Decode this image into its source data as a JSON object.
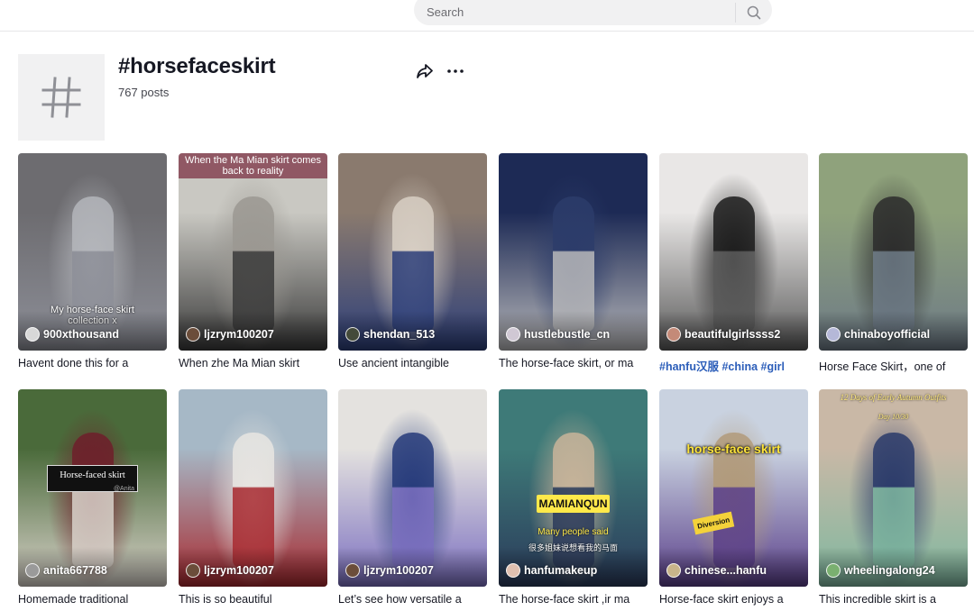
{
  "search": {
    "placeholder": "Search"
  },
  "header": {
    "title": "#horsefaceskirt",
    "post_count": "767 posts"
  },
  "videos": [
    {
      "author": "900xthousand",
      "caption": "Havent done this for a",
      "overlay": "My horse-face skirt collection x",
      "colors": [
        "#6d6c70",
        "#b4b6bb",
        "#8d8f98"
      ],
      "avatar": "#d8d8d8"
    },
    {
      "author": "ljzrym100207",
      "caption": "When zhe Ma Mian skirt",
      "overlay": "When the Ma Mian skirt comes back to reality",
      "colors": [
        "#c9c8c2",
        "#9b9892",
        "#3a3a3a"
      ],
      "avatar": "#6b4d3a"
    },
    {
      "author": "shendan_513",
      "caption": "Use ancient intangible",
      "overlay": "",
      "colors": [
        "#8a7a6e",
        "#d8cfc4",
        "#2d3f7a"
      ],
      "avatar": "#444a3a"
    },
    {
      "author": "hustlebustle_cn",
      "caption": "The horse-face skirt, or ma",
      "overlay": "",
      "colors": [
        "#1d2a55",
        "#2c3c6a",
        "#b8b8ba"
      ],
      "avatar": "#d0c8d4"
    },
    {
      "author": "beautifulgirlssss2",
      "caption": "#hanfu汉服 #china #girl",
      "overlay": "",
      "colors": [
        "#e9e7e6",
        "#1c1c1c",
        "#5a5a5a"
      ],
      "avatar": "#c48a78",
      "caption_is_tags": true
    },
    {
      "author": "chinaboyofficial",
      "caption": "Horse Face Skirt，one of",
      "overlay": "",
      "colors": [
        "#8fa27c",
        "#2c2c2c",
        "#6d7a86"
      ],
      "avatar": "#b5b8d8"
    },
    {
      "author": "anita667788",
      "caption": "Homemade traditional",
      "overlay": "Horse-faced skirt",
      "overlay_sub": "@Anita",
      "colors": [
        "#4a6a3a",
        "#6e1e2a",
        "#d8d2ca"
      ],
      "avatar": "#9a9a9a"
    },
    {
      "author": "ljzrym100207",
      "caption": "This is so beautiful",
      "overlay": "",
      "colors": [
        "#a6b8c6",
        "#e8e6e2",
        "#a82a30"
      ],
      "avatar": "#6b4d3a"
    },
    {
      "author": "ljzrym100207",
      "caption": "Let’s see how versatile a",
      "overlay": "",
      "colors": [
        "#e4e2df",
        "#253a7a",
        "#7b6fc0"
      ],
      "avatar": "#6b4d3a"
    },
    {
      "author": "hanfumakeup",
      "caption": "The horse-face skirt ,ir ma",
      "overlay": "MAMIANQUN",
      "overlay_sub": "Many people said",
      "overlay_sub2": "很多姐妹说想看我的马面",
      "colors": [
        "#3e7a78",
        "#c8b49a",
        "#2a3a5a"
      ],
      "avatar": "#e0c0b0"
    },
    {
      "author": "chinese...hanfu",
      "caption": "Horse-face skirt enjoys a",
      "overlay": "horse-face skirt",
      "overlay_sub": "Diversion",
      "colors": [
        "#c9d2e0",
        "#b19a7a",
        "#5a3f8a"
      ],
      "avatar": "#c8b48a"
    },
    {
      "author": "wheelingalong24",
      "caption": "This incredible skirt is a",
      "overlay": "12 Days of Early Autumn Outfits",
      "overlay_sub": "Day 10/30",
      "colors": [
        "#c9b8a6",
        "#2a3a6a",
        "#7fb8a0"
      ],
      "avatar": "#7ab070"
    }
  ],
  "icons": {
    "hashtag": "hashtag-icon",
    "share": "share-icon",
    "more": "more-icon",
    "search": "search-icon"
  }
}
